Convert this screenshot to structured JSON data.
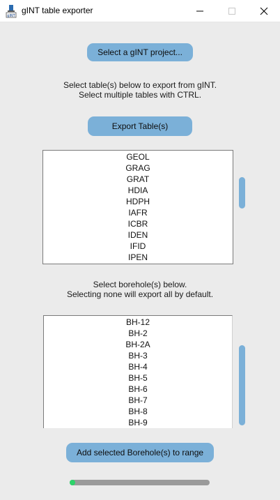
{
  "window": {
    "title": "gINT table exporter",
    "icon": "gint-app-icon"
  },
  "controls": {
    "minimize": "minimize-icon",
    "maximize": "maximize-icon",
    "close": "close-icon"
  },
  "buttons": {
    "select_project": "Select a gINT project...",
    "export_tables": "Export Table(s)",
    "add_boreholes": "Add selected Borehole(s) to range"
  },
  "captions": {
    "tables_line1": "Select table(s) below to export from gINT.",
    "tables_line2": "Select multiple tables with CTRL.",
    "boreholes_line1": "Select borehole(s) below.",
    "boreholes_line2": "Selecting none will export all by default."
  },
  "tables": [
    "GEOL",
    "GRAG",
    "GRAT",
    "HDIA",
    "HDPH",
    "IAFR",
    "ICBR",
    "IDEN",
    "IFID",
    "IPEN"
  ],
  "boreholes": [
    "BH-12",
    "BH-2",
    "BH-2A",
    "BH-3",
    "BH-4",
    "BH-5",
    "BH-6",
    "BH-7",
    "BH-8",
    "BH-9"
  ],
  "progress": {
    "fraction": 0.03
  },
  "colors": {
    "accent": "#7bb0d8",
    "progress": "#2dd36a"
  }
}
